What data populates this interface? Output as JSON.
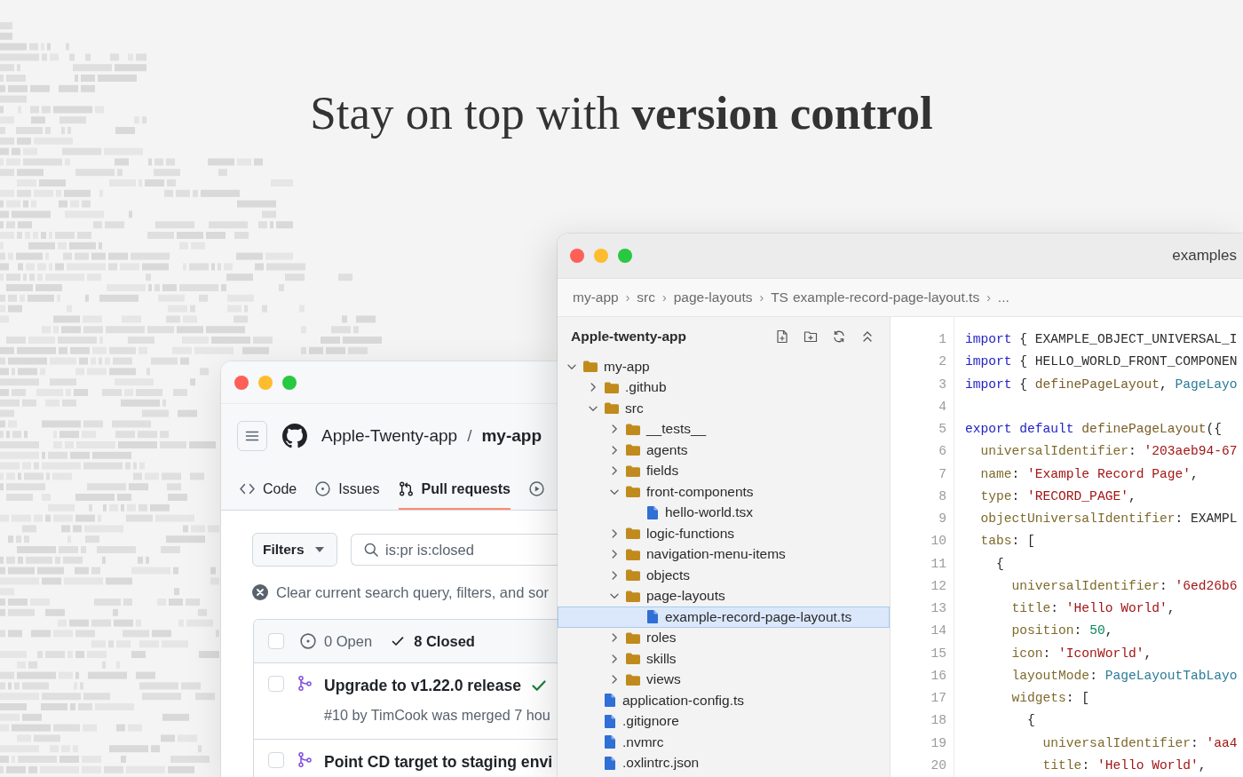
{
  "headline": "Stay on top with **version control**",
  "github_window": {
    "owner": "Apple-Twenty-app",
    "path_separator": "/",
    "repo": "my-app",
    "tabs": [
      {
        "kind": "code",
        "label": "Code",
        "selected": false
      },
      {
        "kind": "issues",
        "label": "Issues",
        "selected": false
      },
      {
        "kind": "pulls",
        "label": "Pull requests",
        "selected": true
      },
      {
        "kind": "play",
        "selected": false
      }
    ],
    "filters_button": "Filters",
    "search": {
      "value": "is:pr is:closed"
    },
    "clear_filters": "Clear current search query, filters, and sor",
    "list_header": {
      "checked": false,
      "states": [
        {
          "kind": "open",
          "label": "0 Open",
          "selected": false
        },
        {
          "kind": "closed",
          "label": "8 Closed",
          "selected": true
        }
      ]
    },
    "pull_requests": [
      {
        "checked": false,
        "merged": true,
        "title": "Upgrade to v1.22.0 release",
        "checks_passed": true,
        "meta": "#10 by TimCook was merged 7 hou"
      },
      {
        "checked": false,
        "merged": true,
        "title": "Point CD target to staging envi"
      }
    ]
  },
  "editor_window": {
    "title": "examples",
    "breadcrumb_separator": "›",
    "breadcrumb": [
      {
        "label": "my-app"
      },
      {
        "label": "src"
      },
      {
        "label": "page-layouts"
      },
      {
        "badge": "TS",
        "label": "example-record-page-layout.ts"
      },
      {
        "label": "..."
      }
    ],
    "explorer": {
      "title": "Apple-twenty-app",
      "tree": [
        {
          "name": "my-app",
          "kind": "folder",
          "expanded": true,
          "selected": false,
          "children": [
            {
              "name": ".github",
              "kind": "folder",
              "expanded": false,
              "selected": false
            },
            {
              "name": "src",
              "kind": "folder",
              "expanded": true,
              "selected": false,
              "children": [
                {
                  "name": "__tests__",
                  "kind": "folder",
                  "expanded": false,
                  "selected": false
                },
                {
                  "name": "agents",
                  "kind": "folder",
                  "expanded": false,
                  "selected": false
                },
                {
                  "name": "fields",
                  "kind": "folder",
                  "expanded": false,
                  "selected": false
                },
                {
                  "name": "front-components",
                  "kind": "folder",
                  "expanded": true,
                  "selected": false,
                  "children": [
                    {
                      "name": "hello-world.tsx",
                      "kind": "file",
                      "selected": false
                    }
                  ]
                },
                {
                  "name": "logic-functions",
                  "kind": "folder",
                  "expanded": false,
                  "selected": false
                },
                {
                  "name": "navigation-menu-items",
                  "kind": "folder",
                  "expanded": false,
                  "selected": false
                },
                {
                  "name": "objects",
                  "kind": "folder",
                  "expanded": false,
                  "selected": false
                },
                {
                  "name": "page-layouts",
                  "kind": "folder",
                  "expanded": true,
                  "selected": false,
                  "children": [
                    {
                      "name": "example-record-page-layout.ts",
                      "kind": "file",
                      "selected": true
                    }
                  ]
                },
                {
                  "name": "roles",
                  "kind": "folder",
                  "expanded": false,
                  "selected": false
                },
                {
                  "name": "skills",
                  "kind": "folder",
                  "expanded": false,
                  "selected": false
                },
                {
                  "name": "views",
                  "kind": "folder",
                  "expanded": false,
                  "selected": false
                }
              ]
            },
            {
              "name": "application-config.ts",
              "kind": "file",
              "selected": false
            },
            {
              "name": ".gitignore",
              "kind": "file",
              "selected": false
            },
            {
              "name": ".nvmrc",
              "kind": "file",
              "selected": false
            },
            {
              "name": ".oxlintrc.json",
              "kind": "file",
              "selected": false
            }
          ]
        }
      ]
    },
    "code": [
      {
        "number": "1",
        "tokens": [
          {
            "kind": "keyword",
            "text": "import"
          },
          {
            "kind": "plain",
            "text": " { EXAMPLE_OBJECT_UNIVERSAL_I"
          }
        ]
      },
      {
        "number": "2",
        "tokens": [
          {
            "kind": "keyword",
            "text": "import"
          },
          {
            "kind": "plain",
            "text": " { HELLO_WORLD_FRONT_COMPONEN"
          }
        ]
      },
      {
        "number": "3",
        "tokens": [
          {
            "kind": "keyword",
            "text": "import"
          },
          {
            "kind": "plain",
            "text": " { "
          },
          {
            "kind": "function",
            "text": "definePageLayout"
          },
          {
            "kind": "plain",
            "text": ", "
          },
          {
            "kind": "type",
            "text": "PageLayo"
          }
        ]
      },
      {
        "number": "4"
      },
      {
        "number": "5",
        "tokens": [
          {
            "kind": "keyword",
            "text": "export default"
          },
          {
            "kind": "function",
            "text": " definePageLayout"
          },
          {
            "kind": "plain",
            "text": "({"
          }
        ]
      },
      {
        "number": "6",
        "tokens": [
          {
            "kind": "property",
            "text": "  universalIdentifier"
          },
          {
            "kind": "plain",
            "text": ": "
          },
          {
            "kind": "string",
            "text": "'203aeb94-67"
          }
        ]
      },
      {
        "number": "7",
        "tokens": [
          {
            "kind": "property",
            "text": "  name"
          },
          {
            "kind": "plain",
            "text": ": "
          },
          {
            "kind": "string",
            "text": "'Example Record Page'"
          },
          {
            "kind": "plain",
            "text": ","
          }
        ]
      },
      {
        "number": "8",
        "tokens": [
          {
            "kind": "property",
            "text": "  type"
          },
          {
            "kind": "plain",
            "text": ": "
          },
          {
            "kind": "string",
            "text": "'RECORD_PAGE'"
          },
          {
            "kind": "plain",
            "text": ","
          }
        ]
      },
      {
        "number": "9",
        "tokens": [
          {
            "kind": "property",
            "text": "  objectUniversalIdentifier"
          },
          {
            "kind": "plain",
            "text": ": EXAMPL"
          }
        ]
      },
      {
        "number": "10",
        "tokens": [
          {
            "kind": "property",
            "text": "  tabs"
          },
          {
            "kind": "plain",
            "text": ": ["
          }
        ]
      },
      {
        "number": "11",
        "tokens": [
          {
            "kind": "plain",
            "text": "    {"
          }
        ]
      },
      {
        "number": "12",
        "tokens": [
          {
            "kind": "property",
            "text": "      universalIdentifier"
          },
          {
            "kind": "plain",
            "text": ": "
          },
          {
            "kind": "string",
            "text": "'6ed26b6"
          }
        ]
      },
      {
        "number": "13",
        "tokens": [
          {
            "kind": "property",
            "text": "      title"
          },
          {
            "kind": "plain",
            "text": ": "
          },
          {
            "kind": "string",
            "text": "'Hello World'"
          },
          {
            "kind": "plain",
            "text": ","
          }
        ]
      },
      {
        "number": "14",
        "tokens": [
          {
            "kind": "property",
            "text": "      position"
          },
          {
            "kind": "plain",
            "text": ": "
          },
          {
            "kind": "number",
            "text": "50"
          },
          {
            "kind": "plain",
            "text": ","
          }
        ]
      },
      {
        "number": "15",
        "tokens": [
          {
            "kind": "property",
            "text": "      icon"
          },
          {
            "kind": "plain",
            "text": ": "
          },
          {
            "kind": "string",
            "text": "'IconWorld'"
          },
          {
            "kind": "plain",
            "text": ","
          }
        ]
      },
      {
        "number": "16",
        "tokens": [
          {
            "kind": "property",
            "text": "      layoutMode"
          },
          {
            "kind": "plain",
            "text": ": "
          },
          {
            "kind": "type",
            "text": "PageLayoutTabLayo"
          }
        ]
      },
      {
        "number": "17",
        "tokens": [
          {
            "kind": "property",
            "text": "      widgets"
          },
          {
            "kind": "plain",
            "text": ": ["
          }
        ]
      },
      {
        "number": "18",
        "tokens": [
          {
            "kind": "plain",
            "text": "        {"
          }
        ]
      },
      {
        "number": "19",
        "tokens": [
          {
            "kind": "property",
            "text": "          universalIdentifier"
          },
          {
            "kind": "plain",
            "text": ": "
          },
          {
            "kind": "string",
            "text": "'aa4"
          }
        ]
      },
      {
        "number": "20",
        "tokens": [
          {
            "kind": "property",
            "text": "          title"
          },
          {
            "kind": "plain",
            "text": ": "
          },
          {
            "kind": "string",
            "text": "'Hello World'"
          },
          {
            "kind": "plain",
            "text": ","
          }
        ]
      }
    ]
  }
}
